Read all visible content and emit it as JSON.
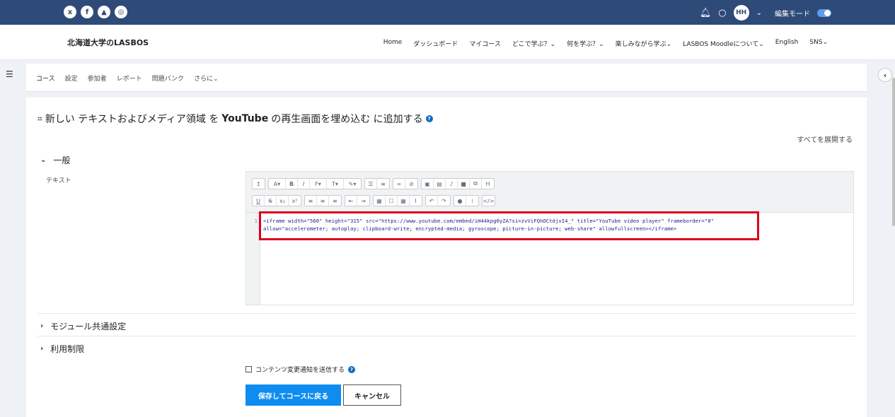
{
  "topbar": {
    "social": [
      "x",
      "f",
      "▲",
      "◎"
    ],
    "avatar": "HH",
    "edit_mode_label": "編集モード"
  },
  "navbar": {
    "brand": "北海道大学のLASBOS",
    "links": [
      "Home",
      "ダッシュボード",
      "マイコース",
      "どこで学ぶ？⌄",
      "何を学ぶ？⌄",
      "楽しみながら学ぶ⌄",
      "LASBOS Moodleについて⌄",
      "English",
      "SNS⌄"
    ]
  },
  "subnav": {
    "tabs": [
      "コース",
      "設定",
      "参加者",
      "レポート",
      "問題バンク",
      "さらに⌄"
    ]
  },
  "main": {
    "heading_prefix": "新しい テキストおよびメディア領域 を ",
    "heading_bold": "YouTube",
    "heading_suffix": "の再生画面を埋め込む に追加する",
    "expand_all": "すべてを展開する",
    "section_general": "一般",
    "field_label": "テキスト",
    "line_number": "1",
    "code_line1": "<iframe width=\"560\" height=\"315\" src=\"https://www.youtube.com/embed/iH44kpg0yZA?si=zvViFQhOCtdjvI4_\" title=\"YouTube video player\" frameborder=\"0\"",
    "code_line2": "allow=\"accelerometer; autoplay; clipboard-write; encrypted-media; gyroscope; picture-in-picture; web-share\" allowfullscreen></iframe>",
    "section_module": "モジュール共通設定",
    "section_restrict": "利用制限",
    "notify_label": "コンテンツ変更通知を送信する",
    "save_button": "保存してコースに戻る",
    "cancel_button": "キャンセル"
  },
  "colors": {
    "topbar": "#2e4a79",
    "primary": "#0f8cf0",
    "highlight": "#e0001b"
  }
}
